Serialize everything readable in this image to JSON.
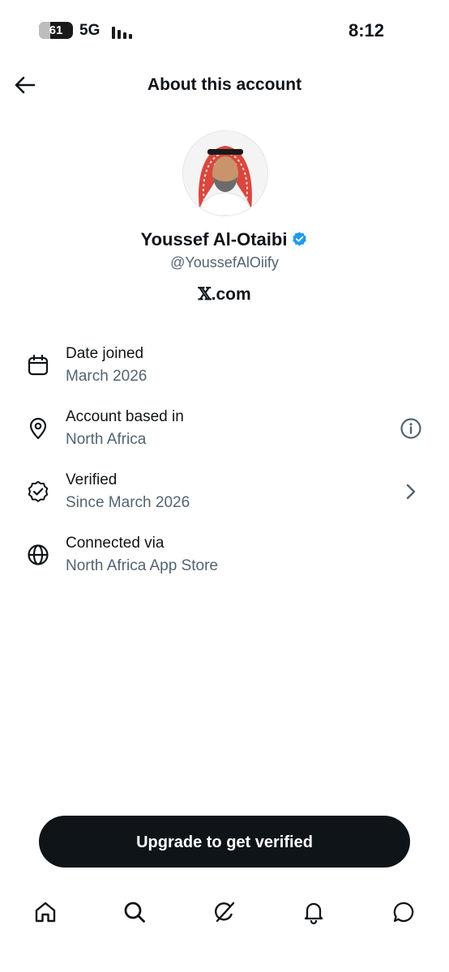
{
  "status_bar": {
    "battery": "61",
    "network": "5G",
    "time": "8:12",
    "icons": {
      "signal": "signal-bars-icon"
    }
  },
  "header": {
    "title": "About this account",
    "back_icon": "back-arrow-icon"
  },
  "profile": {
    "name": "Youssef Al-Otaibi",
    "handle": "@YoussefAlOiify",
    "site_prefix": "𝕏",
    "site_suffix": ".com",
    "verified_color": "#1d9bf0"
  },
  "details": [
    {
      "icon": "calendar-icon",
      "label": "Date joined",
      "value": "March 2026"
    },
    {
      "icon": "location-pin-icon",
      "label": "Account based in",
      "value": "North Africa",
      "action_icon": "info-icon"
    },
    {
      "icon": "verified-badge-outline-icon",
      "label": "Verified",
      "value": "Since March 2026",
      "action_icon": "chevron-right-icon"
    },
    {
      "icon": "globe-icon",
      "label": "Connected via",
      "value": "North Africa App Store"
    }
  ],
  "cta": {
    "label": "Upgrade to get verified"
  },
  "bottom_nav": [
    {
      "name": "home",
      "icon": "home-icon"
    },
    {
      "name": "search",
      "icon": "search-icon"
    },
    {
      "name": "grok",
      "icon": "grok-icon"
    },
    {
      "name": "notifications",
      "icon": "bell-icon"
    },
    {
      "name": "messages",
      "icon": "message-bubble-icon"
    }
  ],
  "colors": {
    "text_primary": "#0f1419",
    "text_secondary": "#536471",
    "accent": "#1d9bf0",
    "button_bg": "#0f1419"
  }
}
